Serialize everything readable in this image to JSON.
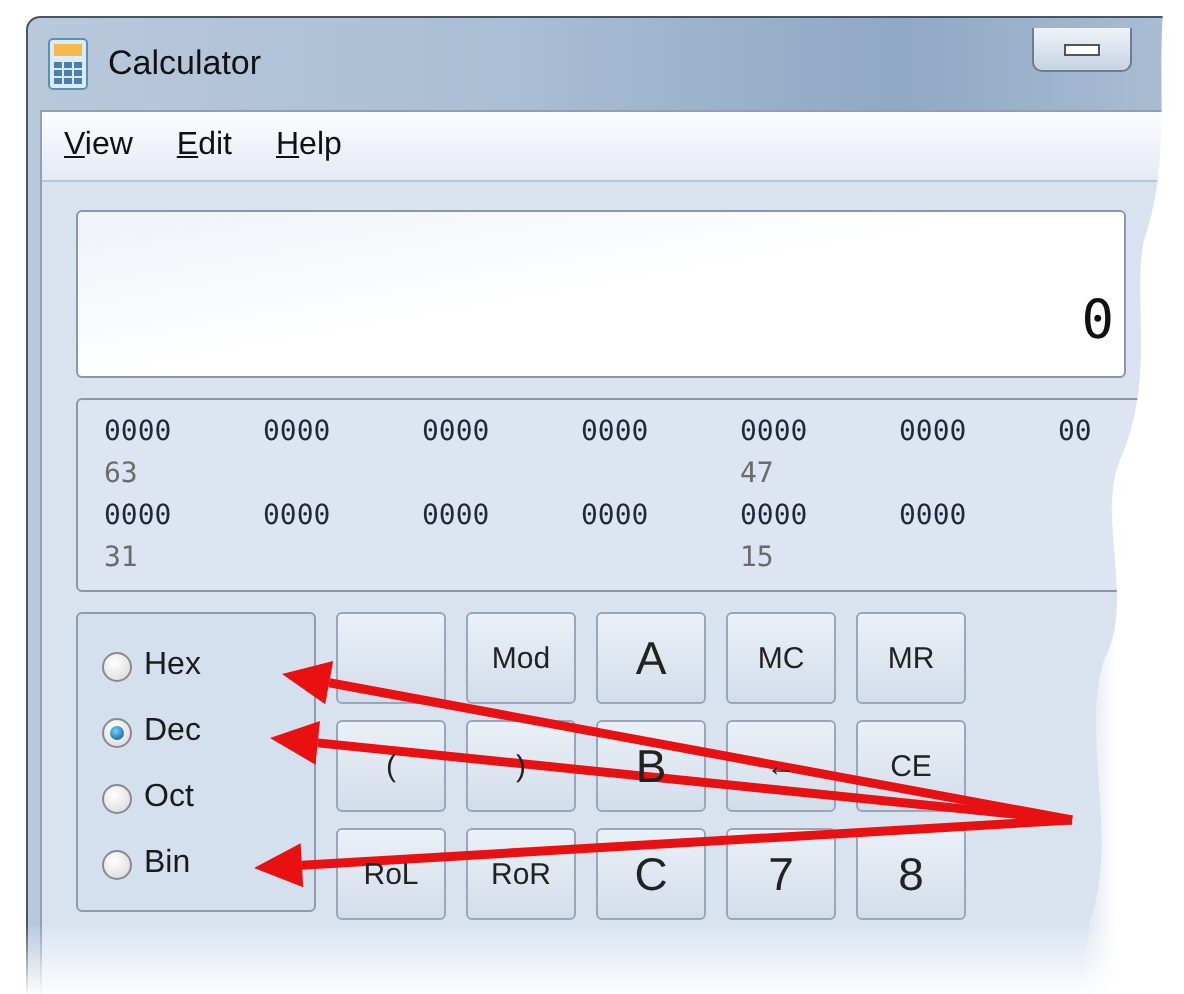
{
  "window": {
    "title": "Calculator"
  },
  "menu": [
    {
      "label": "View"
    },
    {
      "label": "Edit"
    },
    {
      "label": "Help"
    }
  ],
  "display": {
    "value": "0"
  },
  "bits": [
    {
      "groups": [
        "0000",
        "0000",
        "0000",
        "0000",
        "0000",
        "0000",
        "00"
      ],
      "markers": [
        "63",
        "47"
      ]
    },
    {
      "groups": [
        "0000",
        "0000",
        "0000",
        "0000",
        "0000",
        "0000"
      ],
      "markers": [
        "31",
        "15"
      ]
    }
  ],
  "number_system": [
    {
      "label": "Hex",
      "selected": false
    },
    {
      "label": "Dec",
      "selected": true
    },
    {
      "label": "Oct",
      "selected": false
    },
    {
      "label": "Bin",
      "selected": false
    }
  ],
  "keys": [
    [
      {
        "kind": "blank"
      },
      {
        "kind": "function",
        "label": "Mod"
      },
      {
        "kind": "digit",
        "label": "A"
      },
      {
        "kind": "function",
        "label": "MC"
      },
      {
        "kind": "function",
        "label": "MR"
      }
    ],
    [
      {
        "kind": "function",
        "label": "("
      },
      {
        "kind": "function",
        "label": ")"
      },
      {
        "kind": "digit",
        "label": "B"
      },
      {
        "kind": "function",
        "label": "←"
      },
      {
        "kind": "function",
        "label": "CE"
      }
    ],
    [
      {
        "kind": "function",
        "label": "RoL"
      },
      {
        "kind": "function",
        "label": "RoR"
      },
      {
        "kind": "digit",
        "label": "C"
      },
      {
        "kind": "digit",
        "label": "7"
      },
      {
        "kind": "digit",
        "label": "8"
      }
    ]
  ]
}
